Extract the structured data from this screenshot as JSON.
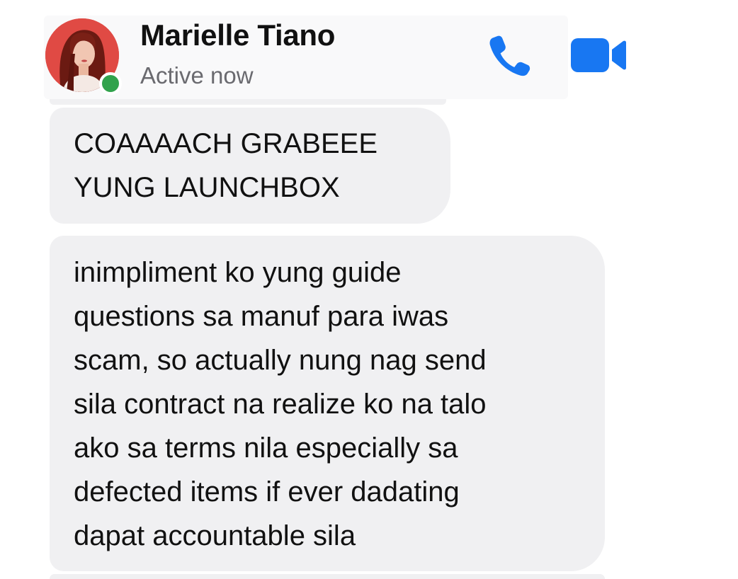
{
  "header": {
    "contact_name": "Marielle Tiano",
    "status": "Active now",
    "avatar_icon": "profile-photo",
    "call_icon": "phone-icon",
    "video_icon": "video-camera-icon",
    "accent_color": "#1877f2",
    "online_color": "#31a24c"
  },
  "messages": [
    {
      "lines": [
        "COAAAACH GRABEEE",
        "YUNG LAUNCHBOX"
      ]
    },
    {
      "lines": [
        "inimpliment ko yung guide",
        "questions sa manuf para iwas",
        "scam, so actually nung nag send",
        "sila contract na realize ko na talo",
        "ako sa terms nila especially sa",
        "defected items if ever dadating",
        "dapat accountable sila"
      ]
    }
  ],
  "bubble_color": "#f0f0f2"
}
